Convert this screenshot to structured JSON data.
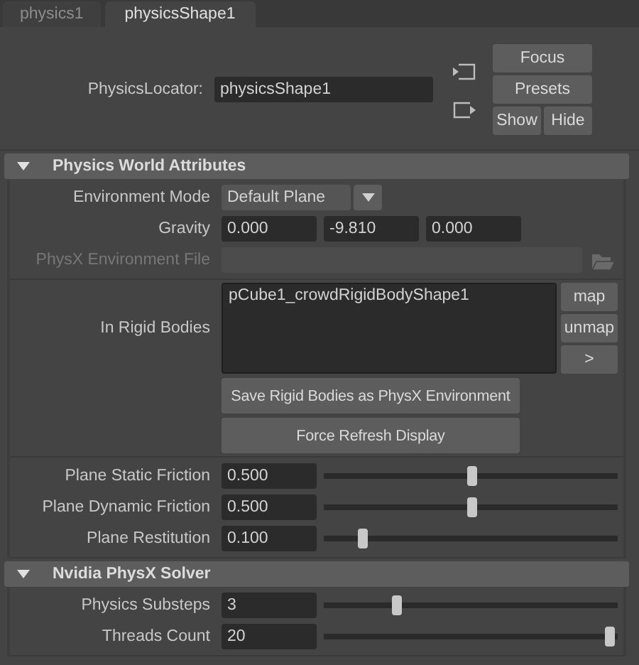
{
  "tabs": [
    {
      "label": "physics1",
      "selected": false
    },
    {
      "label": "physicsShape1",
      "selected": true
    }
  ],
  "locator": {
    "label": "PhysicsLocator:",
    "value": "physicsShape1"
  },
  "header_buttons": [
    "Focus",
    "Presets",
    "Show",
    "Hide"
  ],
  "sections": [
    {
      "title": "Physics World Attributes",
      "expanded": true,
      "groups": [
        [
          {
            "kind": "dropdown",
            "label": "Environment Mode",
            "value": "Default Plane",
            "disabled": false
          },
          {
            "kind": "vector",
            "label": "Gravity",
            "values": [
              "0.000",
              "-9.810",
              "0.000"
            ],
            "disabled": false
          },
          {
            "kind": "file",
            "label": "PhysX Environment File",
            "disabled": true
          }
        ],
        [
          {
            "kind": "list",
            "label": "In Rigid Bodies",
            "items": [
              "pCube1_crowdRigidBodyShape1"
            ],
            "buttons": [
              "map",
              "unmap",
              ">"
            ],
            "disabled": false
          },
          {
            "kind": "button",
            "label": "Save Rigid Bodies as PhysX Environment",
            "disabled": false
          },
          {
            "kind": "button",
            "label": "Force Refresh Display",
            "disabled": false
          }
        ],
        [
          {
            "kind": "slider",
            "label": "Plane Static Friction",
            "value": "0.500",
            "level": 0.5,
            "disabled": false
          },
          {
            "kind": "slider",
            "label": "Plane Dynamic Friction",
            "value": "0.500",
            "level": 0.5,
            "disabled": false
          },
          {
            "kind": "slider",
            "label": "Plane Restitution",
            "value": "0.100",
            "level": 0.12,
            "disabled": false
          }
        ]
      ]
    },
    {
      "title": "Nvidia PhysX Solver",
      "expanded": true,
      "groups": [
        [
          {
            "kind": "slider",
            "label": "Physics Substeps",
            "value": "3",
            "level": 0.24,
            "disabled": false
          },
          {
            "kind": "slider",
            "label": "Threads Count",
            "value": "20",
            "level": 0.985,
            "disabled": false
          }
        ]
      ]
    }
  ]
}
